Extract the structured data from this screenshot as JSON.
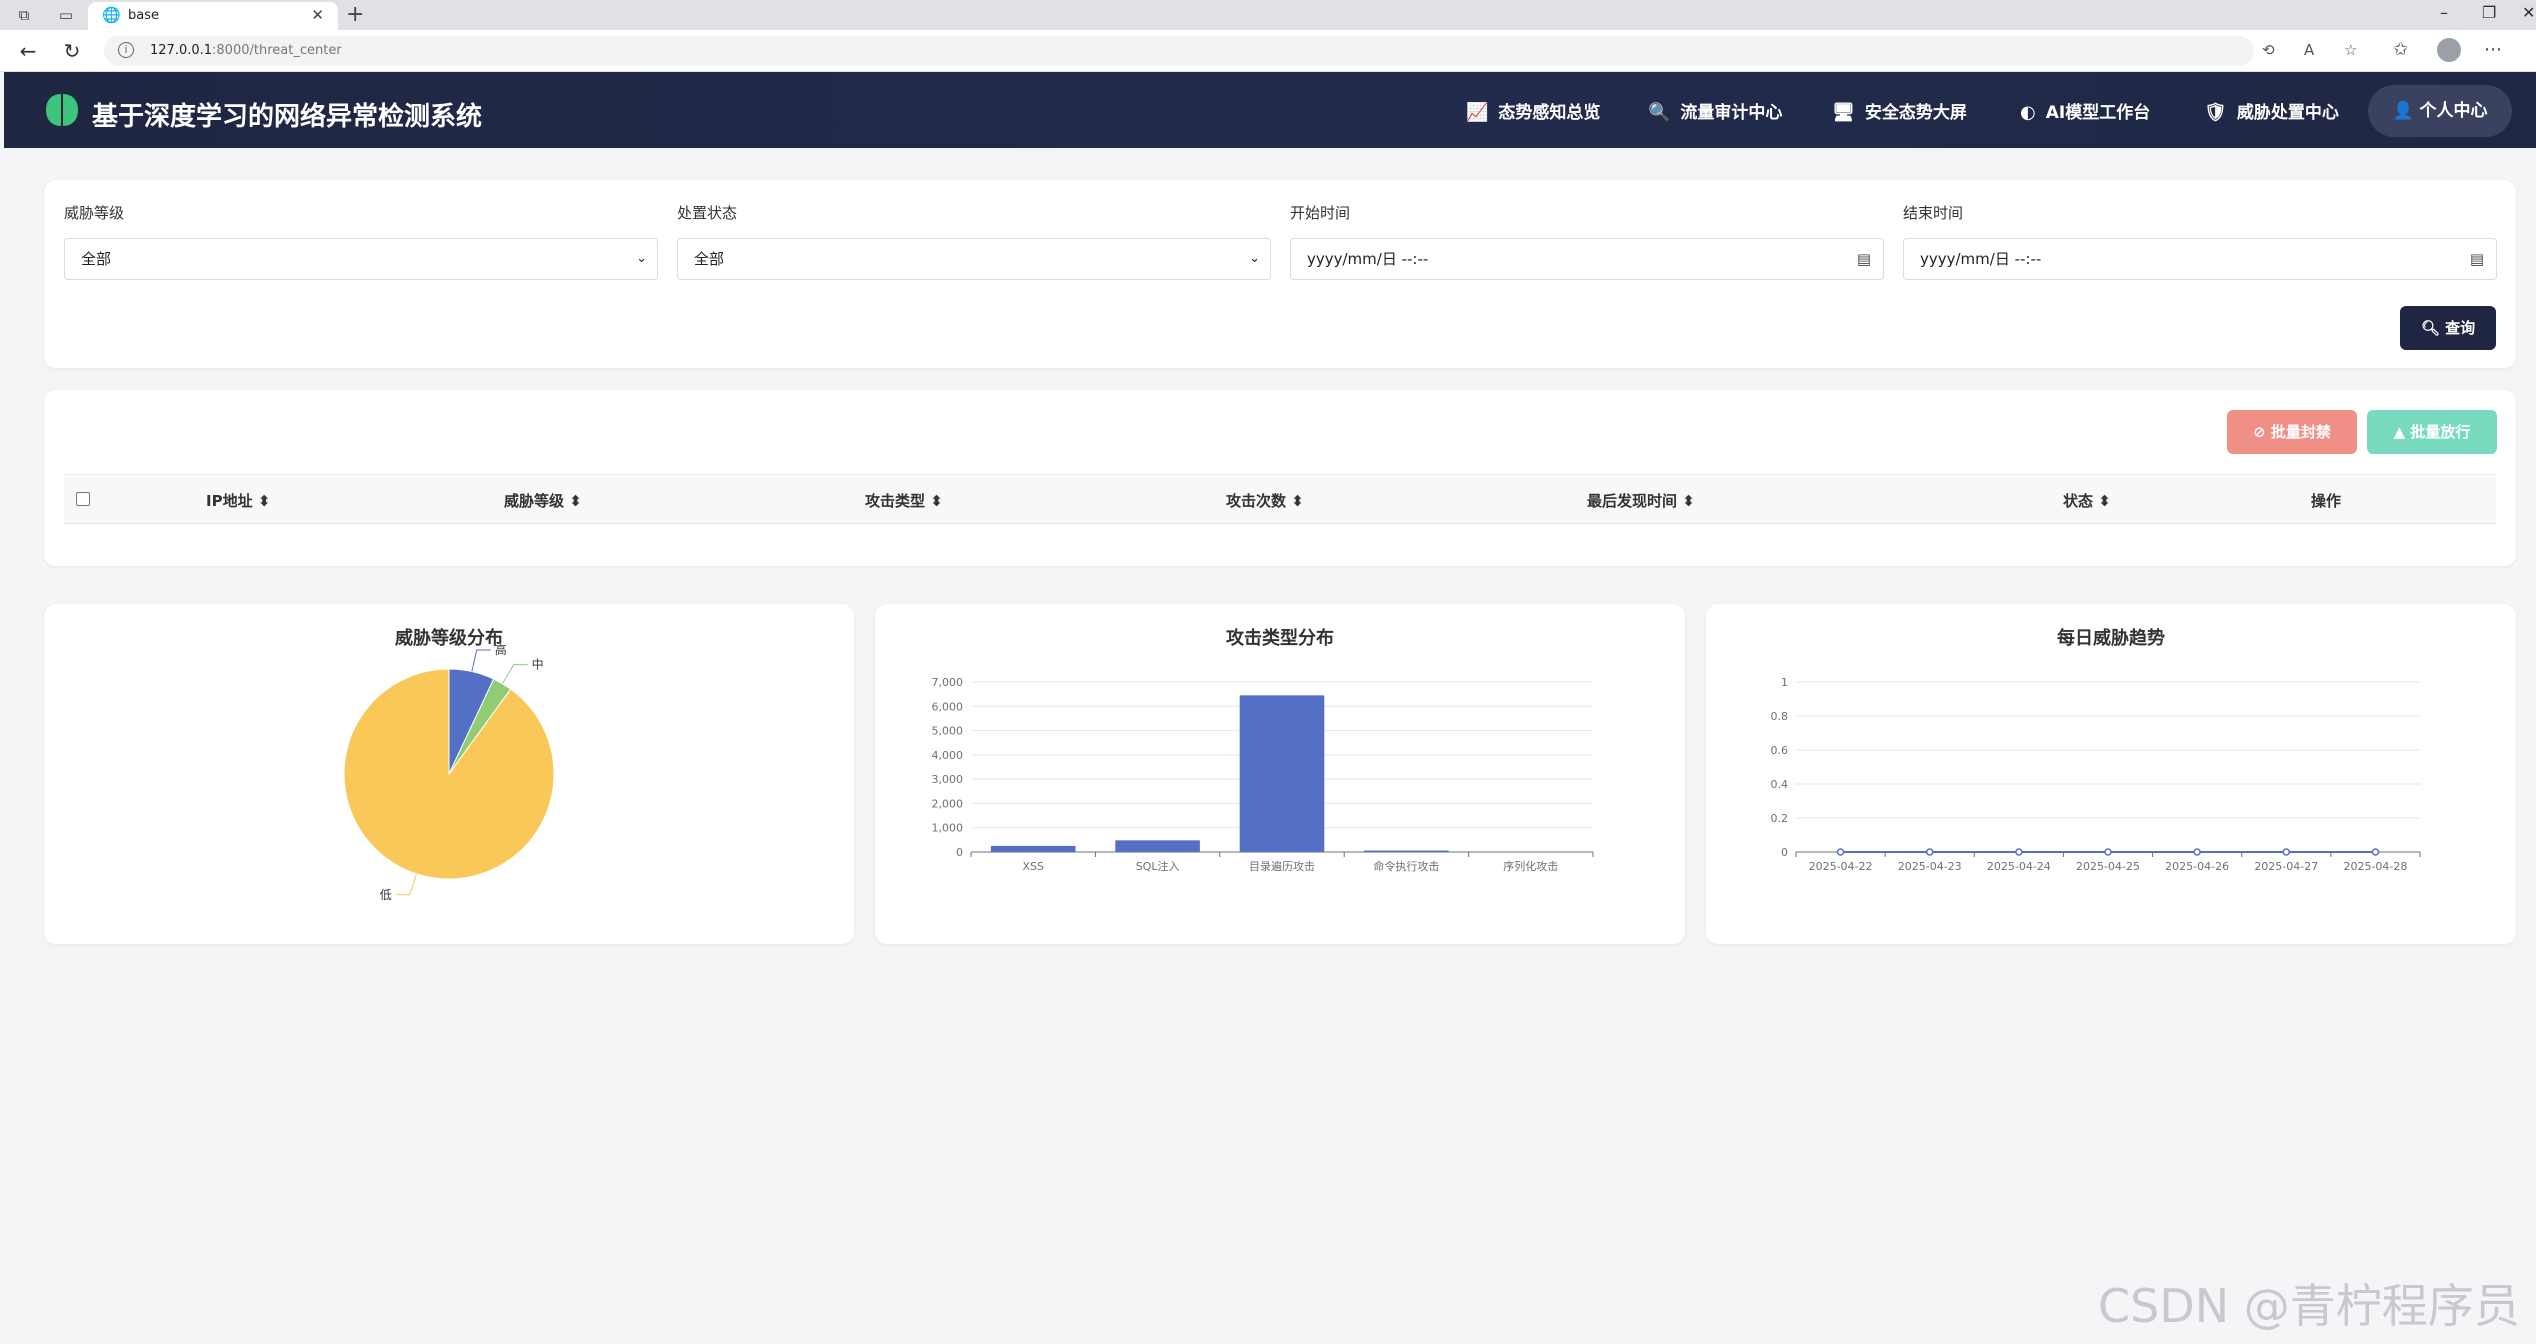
{
  "browser": {
    "tab_title": "base",
    "url_host": "127.0.0.1",
    "url_path": ":8000/threat_center"
  },
  "header": {
    "title": "基于深度学习的网络异常检测系统",
    "nav": [
      {
        "label": "态势感知总览",
        "icon": "chart-line-icon"
      },
      {
        "label": "流量审计中心",
        "icon": "search-icon"
      },
      {
        "label": "安全态势大屏",
        "icon": "monitor-icon"
      },
      {
        "label": "AI模型工作台",
        "icon": "brain-icon"
      },
      {
        "label": "威胁处置中心",
        "icon": "shield-icon"
      }
    ],
    "user_center": "个人中心"
  },
  "filters": {
    "threat_level_label": "威胁等级",
    "threat_level_value": "全部",
    "status_label": "处置状态",
    "status_value": "全部",
    "start_label": "开始时间",
    "start_placeholder": "yyyy/mm/日 --:--",
    "end_label": "结束时间",
    "end_placeholder": "yyyy/mm/日 --:--",
    "query_button": "查询"
  },
  "table": {
    "batch_block": "批量封禁",
    "batch_allow": "批量放行",
    "columns": [
      "IP地址",
      "威胁等级",
      "攻击类型",
      "攻击次数",
      "最后发现时间",
      "状态",
      "操作"
    ]
  },
  "colors": {
    "accent": "#1e2642",
    "blue": "#5470c6",
    "green": "#91cc75",
    "yellow": "#fac858",
    "block": "#f08f86",
    "allow": "#78dbc0"
  },
  "chart_data": [
    {
      "type": "pie",
      "title": "威胁等级分布",
      "categories": [
        "高",
        "中",
        "低"
      ],
      "values": [
        7,
        3,
        90
      ]
    },
    {
      "type": "bar",
      "title": "攻击类型分布",
      "categories": [
        "XSS",
        "SQL注入",
        "目录遍历攻击",
        "命令执行攻击",
        "序列化攻击"
      ],
      "values": [
        250,
        480,
        6450,
        60,
        0
      ],
      "ylim": [
        0,
        7000
      ],
      "yticks": [
        "0",
        "1,000",
        "2,000",
        "3,000",
        "4,000",
        "5,000",
        "6,000",
        "7,000"
      ]
    },
    {
      "type": "line",
      "title": "每日威胁趋势",
      "categories": [
        "2025-04-22",
        "2025-04-23",
        "2025-04-24",
        "2025-04-25",
        "2025-04-26",
        "2025-04-27",
        "2025-04-28"
      ],
      "values": [
        0,
        0,
        0,
        0,
        0,
        0,
        0
      ],
      "ylim": [
        0,
        1
      ],
      "yticks": [
        "0",
        "0.2",
        "0.4",
        "0.6",
        "0.8",
        "1"
      ]
    }
  ],
  "watermark": "CSDN @青柠程序员"
}
